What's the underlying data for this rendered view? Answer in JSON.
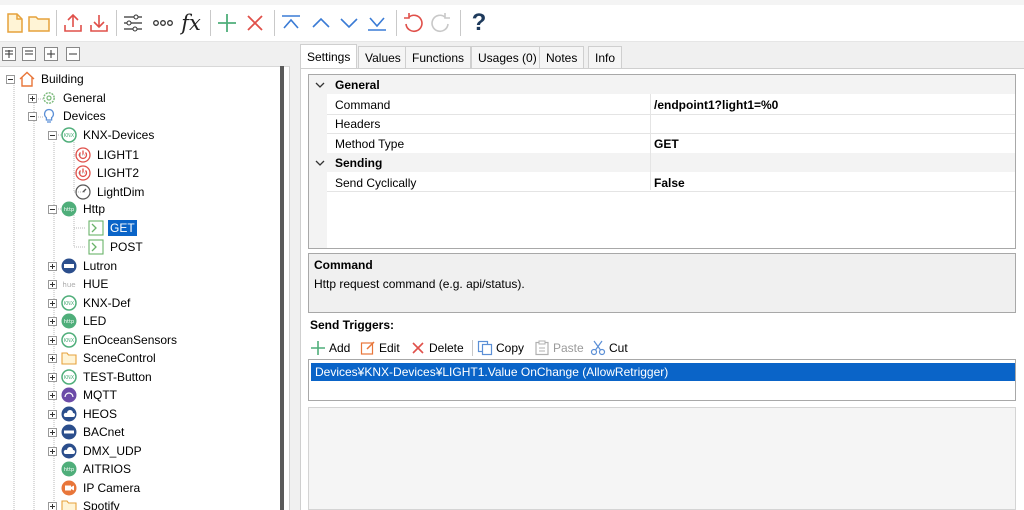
{
  "toolbar": {
    "icons": [
      "new-file-icon",
      "open-folder-icon",
      "upload-icon",
      "download-icon",
      "settings-sliders-icon",
      "more-icon",
      "fx-icon",
      "add-icon",
      "delete-icon",
      "move-top-icon",
      "move-up-icon",
      "move-down-icon",
      "move-bottom-icon",
      "undo-icon",
      "redo-icon",
      "help-icon"
    ],
    "fx_label": "fx",
    "help_label": "?"
  },
  "tree_tools": [
    "expand-all-icon",
    "collapse-all-icon",
    "expand-icon",
    "collapse-icon"
  ],
  "tree": {
    "building": "Building",
    "general": "General",
    "devices": "Devices",
    "knx_devices": "KNX-Devices",
    "light1": "LIGHT1",
    "light2": "LIGHT2",
    "lightdim": "LightDim",
    "http": "Http",
    "get": "GET",
    "post": "POST",
    "lutron": "Lutron",
    "hue": "HUE",
    "knx_def": "KNX-Def",
    "led": "LED",
    "enocean": "EnOceanSensors",
    "scenecontrol": "SceneControl",
    "test_button": "TEST-Button",
    "mqtt": "MQTT",
    "heos": "HEOS",
    "bacnet": "BACnet",
    "dmx_udp": "DMX_UDP",
    "aitrios": "AITRIOS",
    "ip_camera": "IP Camera",
    "spotify": "Spotify"
  },
  "tabs": [
    "Settings",
    "Values",
    "Functions",
    "Usages (0)",
    "Notes",
    "Info"
  ],
  "properties": {
    "cat_general": "General",
    "command_name": "Command",
    "command_value": "/endpoint1?light1=%0",
    "headers_name": "Headers",
    "headers_value": "",
    "method_name": "Method Type",
    "method_value": "GET",
    "cat_sending": "Sending",
    "cyclic_name": "Send Cyclically",
    "cyclic_value": "False"
  },
  "description": {
    "title": "Command",
    "text": "Http request command (e.g. api/status)."
  },
  "triggers": {
    "label": "Send Triggers:",
    "add": "Add",
    "edit": "Edit",
    "delete": "Delete",
    "copy": "Copy",
    "paste": "Paste",
    "cut": "Cut",
    "items": [
      "Devices¥KNX-Devices¥LIGHT1.Value OnChange (AllowRetrigger)"
    ]
  },
  "colors": {
    "accent": "#0a64c8",
    "orange_icon": "#e8763a",
    "knx_green": "#4fae7a",
    "light_red": "#e0504a"
  }
}
